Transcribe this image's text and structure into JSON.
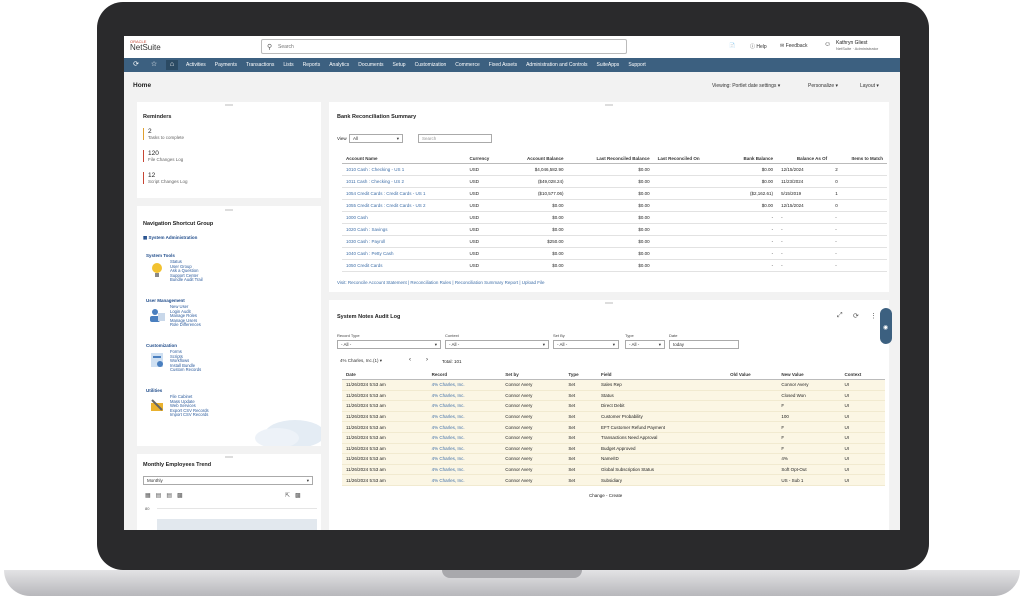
{
  "app": {
    "brand_small": "ORACLE",
    "brand": "NetSuite"
  },
  "search": {
    "placeholder": "Search"
  },
  "toolbar": {
    "help": "Help",
    "feedback": "Feedback"
  },
  "user": {
    "name": "Kathryn Gliest",
    "role": "NetSuite · Administrator"
  },
  "nav": {
    "items": [
      "Activities",
      "Payments",
      "Transactions",
      "Lists",
      "Reports",
      "Analytics",
      "Documents",
      "Setup",
      "Customization",
      "Commerce",
      "Fixed Assets",
      "Administration and Controls",
      "SuiteApps",
      "Support"
    ]
  },
  "page": {
    "title": "Home",
    "viewing": "Viewing: Portlet date settings",
    "personalize": "Personalize",
    "layout": "Layout"
  },
  "reminders": {
    "title": "Reminders",
    "items": [
      {
        "count": "2",
        "label": "Tasks to complete",
        "color": "#e0a030"
      },
      {
        "count": "120",
        "label": "File Changes Log",
        "color": "#c74634"
      },
      {
        "count": "12",
        "label": "Script Changes Log",
        "color": "#c74634"
      }
    ]
  },
  "shortcuts": {
    "title": "Navigation Shortcut Group",
    "section": "System Administration",
    "groups": [
      {
        "name": "System Tools",
        "links": [
          "Status",
          "User Group",
          "Ask a Question",
          "Support Center",
          "Bundle Audit Trail"
        ]
      },
      {
        "name": "User Management",
        "links": [
          "New User",
          "Login Audit",
          "Manage Roles",
          "Manage Users",
          "Role Differences"
        ]
      },
      {
        "name": "Customization",
        "links": [
          "Forms",
          "Scripts",
          "Workflows",
          "Install Bundle",
          "Custom Records"
        ]
      },
      {
        "name": "Utilities",
        "links": [
          "File Cabinet",
          "Mass Update",
          "Web Services",
          "Export CSV Records",
          "Import CSV Records"
        ]
      }
    ]
  },
  "trend": {
    "title": "Monthly Employees Trend",
    "period": "Monthly",
    "y_tick": "80"
  },
  "bank": {
    "title": "Bank Reconciliation Summary",
    "view_label": "View",
    "view_value": "All",
    "search_placeholder": "Search",
    "columns": [
      "Account Name",
      "Currency",
      "Account Balance",
      "Last Reconciled Balance",
      "Last Reconciled On",
      "Bank Balance",
      "Balance As Of",
      "Items to Match"
    ],
    "rows": [
      [
        "1010 Cash : Checking - US 1",
        "USD",
        "$4,046,582.90",
        "$0.00",
        "",
        "$0.00",
        "12/15/2024",
        "2"
      ],
      [
        "1011 Cash : Checking - US 2",
        "USD",
        "($49,028.24)",
        "$0.00",
        "",
        "$0.00",
        "11/23/2024",
        "0"
      ],
      [
        "1054 Credit Cards : Credit Cards - US 1",
        "USD",
        "($10,577.06)",
        "$0.00",
        "",
        "($2,162.61)",
        "5/15/2019",
        "1"
      ],
      [
        "1055 Credit Cards : Credit Cards - US 2",
        "USD",
        "$0.00",
        "$0.00",
        "",
        "$0.00",
        "12/15/2024",
        "0"
      ],
      [
        "1000 Cash",
        "USD",
        "$0.00",
        "$0.00",
        "",
        "-",
        "-",
        "-"
      ],
      [
        "1020 Cash : Savings",
        "USD",
        "$0.00",
        "$0.00",
        "",
        "-",
        "-",
        "-"
      ],
      [
        "1030 Cash : Payroll",
        "USD",
        "$250.00",
        "$0.00",
        "",
        "-",
        "-",
        "-"
      ],
      [
        "1040 Cash : Petty Cash",
        "USD",
        "$0.00",
        "$0.00",
        "",
        "-",
        "-",
        "-"
      ],
      [
        "1050 Credit Cards",
        "USD",
        "$0.00",
        "$0.00",
        "",
        "-",
        "-",
        "-"
      ]
    ],
    "footer": "Visit: Reconcile Account Statement | Reconciliation Rules | Reconciliation Summary Report | Upload File"
  },
  "audit": {
    "title": "System Notes Audit Log",
    "filters": [
      {
        "label": "Record Type",
        "value": "- All -"
      },
      {
        "label": "Context",
        "value": "- All -"
      },
      {
        "label": "Set By",
        "value": "- All -"
      },
      {
        "label": "Type",
        "value": "- All -"
      },
      {
        "label": "Date",
        "value": "today"
      }
    ],
    "record_selector": "4% Charles, Inc.(1)",
    "total": "Total: 101",
    "columns": [
      "Date",
      "Record",
      "Set by",
      "Type",
      "Field",
      "Old Value",
      "New Value",
      "Context"
    ],
    "rows": [
      [
        "11/26/2024 5:53 am",
        "4% Charles, Inc.",
        "Connor Avery",
        "Set",
        "Sales Rep",
        "",
        "Connor Avery",
        "UI"
      ],
      [
        "11/26/2024 5:53 am",
        "4% Charles, Inc.",
        "Connor Avery",
        "Set",
        "Status",
        "",
        "Closed Won",
        "UI"
      ],
      [
        "11/26/2024 5:53 am",
        "4% Charles, Inc.",
        "Connor Avery",
        "Set",
        "Direct Debit",
        "",
        "F",
        "UI"
      ],
      [
        "11/26/2024 5:53 am",
        "4% Charles, Inc.",
        "Connor Avery",
        "Set",
        "Customer Probability",
        "",
        "100",
        "UI"
      ],
      [
        "11/26/2024 5:53 am",
        "4% Charles, Inc.",
        "Connor Avery",
        "Set",
        "EFT Customer Refund Payment",
        "",
        "F",
        "UI"
      ],
      [
        "11/26/2024 5:53 am",
        "4% Charles, Inc.",
        "Connor Avery",
        "Set",
        "Transactions Need Approval",
        "",
        "F",
        "UI"
      ],
      [
        "11/26/2024 5:53 am",
        "4% Charles, Inc.",
        "Connor Avery",
        "Set",
        "Budget Approved",
        "",
        "F",
        "UI"
      ],
      [
        "11/26/2024 5:53 am",
        "4% Charles, Inc.",
        "Connor Avery",
        "Set",
        "Name/ID",
        "",
        "4%",
        "UI"
      ],
      [
        "11/26/2024 5:53 am",
        "4% Charles, Inc.",
        "Connor Avery",
        "Set",
        "Global Subscription Status",
        "",
        "Soft Opt-Out",
        "UI"
      ],
      [
        "11/26/2024 5:53 am",
        "4% Charles, Inc.",
        "Connor Avery",
        "Set",
        "Subsidiary",
        "",
        "US - Sub 1",
        "UI"
      ]
    ],
    "footer": "Change - Create"
  }
}
